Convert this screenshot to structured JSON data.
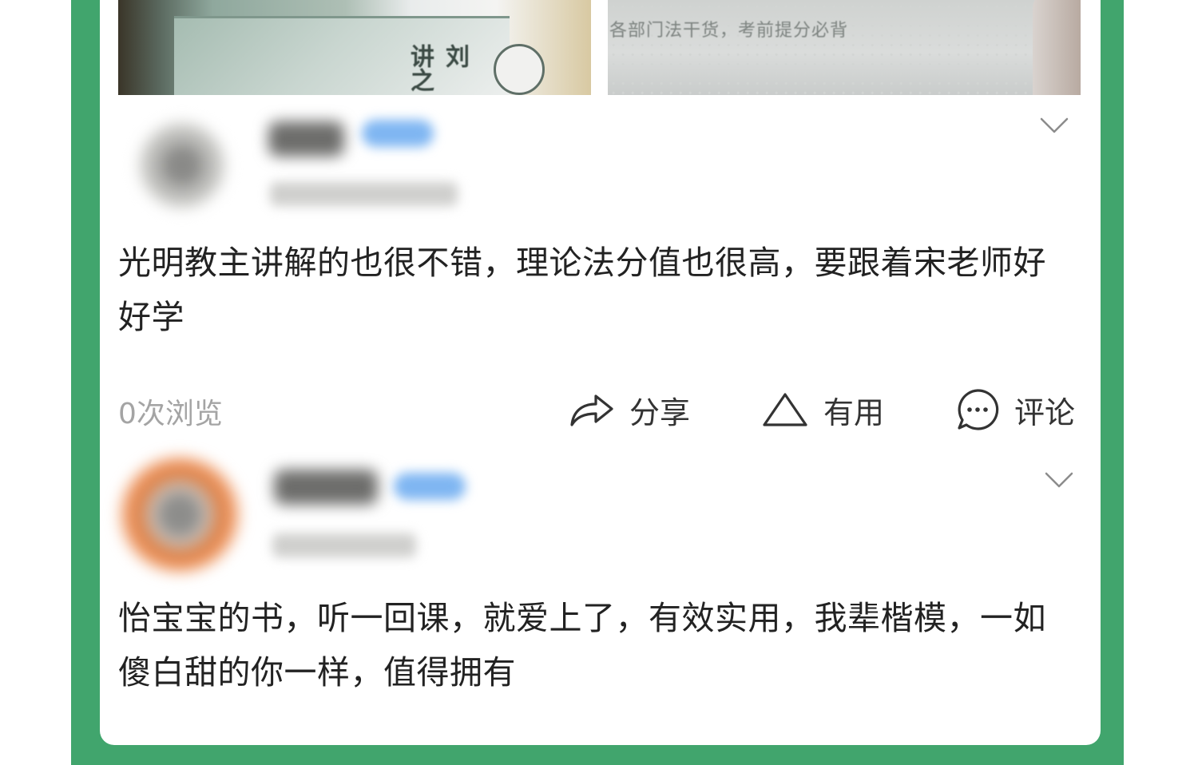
{
  "reviews": [
    {
      "text": "光明教主讲解的也很不错，理论法分值也很高，要跟着宋老师好好学"
    },
    {
      "text": "怡宝宝的书，听一回课，就爱上了，有效实用，我辈楷模，一如傻白甜的你一样，值得拥有"
    }
  ],
  "photos": [
    {
      "text": "刘 讲之"
    },
    {
      "text": "各部门法干货，考前提分必背"
    }
  ],
  "actions": {
    "views": "0次浏览",
    "share": "分享",
    "useful": "有用",
    "comment": "评论"
  },
  "icons": {
    "share": "share-arrow-icon",
    "useful": "triangle-up-icon",
    "comment": "chat-bubble-icon",
    "more": "chevron-down-icon"
  },
  "colors": {
    "frame": "#41a56d",
    "card": "#ffffff",
    "text": "#222222",
    "muted": "#a4a4a4"
  }
}
